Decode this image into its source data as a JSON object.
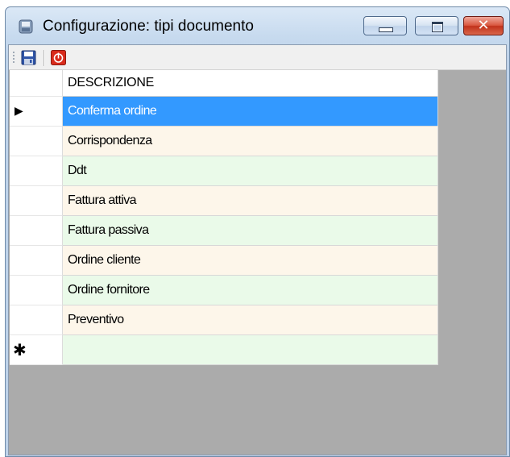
{
  "window": {
    "title": "Configurazione: tipi documento",
    "close_glyph": "✕",
    "icons": {
      "app": "app-icon",
      "minimize": "minimize-icon",
      "maximize": "maximize-icon",
      "close": "close-icon"
    }
  },
  "toolbar": {
    "save_icon": "save-icon",
    "exit_icon": "power-icon",
    "accent": "#d92b1c"
  },
  "grid": {
    "column_header": "DESCRIZIONE",
    "current_row_marker": "▶",
    "new_row_marker": "✱",
    "rows": [
      "Conferma ordine",
      "Corrispondenza",
      "Ddt",
      "Fattura attiva",
      "Fattura passiva",
      "Ordine cliente",
      "Ordine fornitore",
      "Preventivo"
    ],
    "new_row_value": "",
    "selected_index": 0,
    "colors": {
      "selection": "#3399ff",
      "row_alt_a": "#fdf6ea",
      "row_alt_b": "#eafae9"
    }
  }
}
